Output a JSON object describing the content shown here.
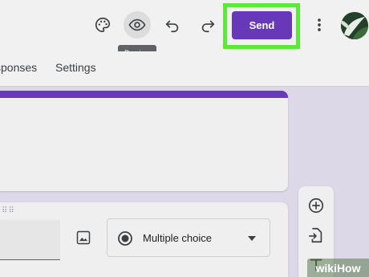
{
  "header": {
    "tooltip": "Preview",
    "send_label": "Send",
    "icons": {
      "palette": "palette-icon",
      "preview": "eye-icon",
      "undo": "undo-icon",
      "redo": "redo-icon",
      "more": "more-vert-icon"
    }
  },
  "tabs": {
    "responses": "sponses",
    "settings": "Settings"
  },
  "question": {
    "type_label": "Multiple choice",
    "drag_handle": "⠿⠿"
  },
  "side_toolbar": {
    "icons": [
      "add-circle-icon",
      "import-icon",
      "title-icon"
    ]
  },
  "watermark": "wikiHow",
  "colors": {
    "accent": "#673ab7",
    "send_button": "#6738b8",
    "highlight": "#5ee83e"
  }
}
